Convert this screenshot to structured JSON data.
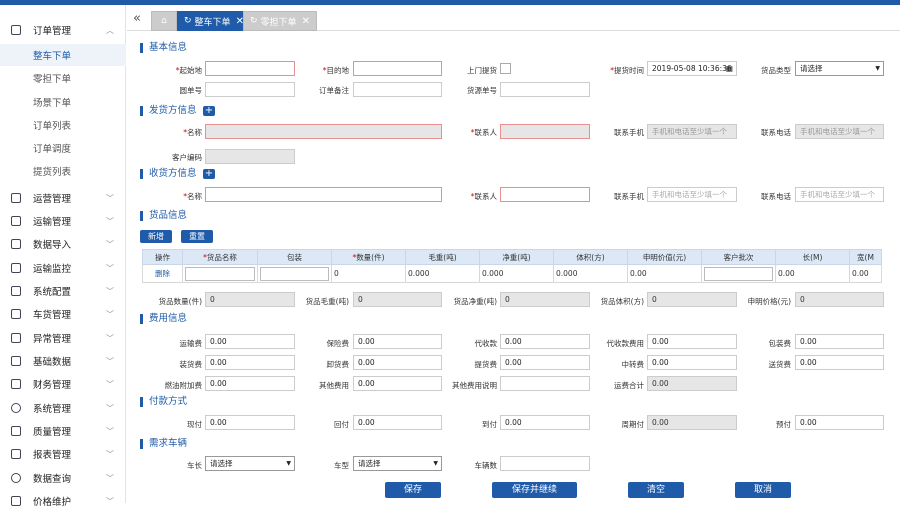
{
  "sidebar": {
    "menus": [
      {
        "label": "订单管理",
        "icon": "document-icon",
        "expanded": true
      },
      {
        "label": "运营管理",
        "icon": "monitor-icon"
      },
      {
        "label": "运输管理",
        "icon": "truck-icon"
      },
      {
        "label": "数据导入",
        "icon": "upload-icon"
      },
      {
        "label": "运输监控",
        "icon": "camera-icon"
      },
      {
        "label": "系统配置",
        "icon": "settings-icon"
      },
      {
        "label": "车货管理",
        "icon": "cart-icon"
      },
      {
        "label": "异常管理",
        "icon": "warning-icon"
      },
      {
        "label": "基础数据",
        "icon": "grid-icon"
      },
      {
        "label": "财务管理",
        "icon": "finance-icon"
      },
      {
        "label": "系统管理",
        "icon": "gear-icon"
      },
      {
        "label": "质量管理",
        "icon": "shield-icon"
      },
      {
        "label": "报表管理",
        "icon": "report-icon"
      },
      {
        "label": "数据查询",
        "icon": "search-icon"
      },
      {
        "label": "价格维护",
        "icon": "price-icon"
      }
    ],
    "sub_items": [
      "整车下单",
      "零担下单",
      "场景下单",
      "订单列表",
      "订单调度",
      "提货列表"
    ]
  },
  "tabs": [
    {
      "label": "整车下单",
      "active": true
    },
    {
      "label": "零担下单",
      "active": false
    }
  ],
  "basic": {
    "title": "基本信息",
    "origin_label": "起始地",
    "dest_label": "目的地",
    "pickup_label": "上门提货",
    "pickup_time_label": "提货时间",
    "pickup_time_value": "2019-05-08 10:36:36",
    "goods_type_label": "货品类型",
    "goods_type_value": "请选择",
    "circle_no_label": "圆单号",
    "order_note_label": "订单备注",
    "source_no_label": "货源单号"
  },
  "shipper": {
    "title": "发货方信息",
    "name_label": "名称",
    "contact_label": "联系人",
    "mobile_label": "联系手机",
    "mobile_ph": "手机和电话至少填一个",
    "phone_label": "联系电话",
    "phone_ph": "手机和电话至少填一个",
    "code_label": "客户编码"
  },
  "receiver": {
    "title": "收货方信息",
    "name_label": "名称",
    "contact_label": "联系人",
    "mobile_label": "联系手机",
    "mobile_ph": "手机和电话至少填一个",
    "phone_label": "联系电话",
    "phone_ph": "手机和电话至少填一个"
  },
  "goods": {
    "title": "货品信息",
    "add_label": "新增",
    "reset_label": "重置",
    "columns": [
      "操作",
      "货品名称",
      "包装",
      "数量(件)",
      "毛重(吨)",
      "净重(吨)",
      "体积(方)",
      "申明价值(元)",
      "客户批次",
      "长(M)",
      "宽(M"
    ],
    "row": {
      "delete": "删除",
      "qty": "0",
      "gross": "0.000",
      "net": "0.000",
      "volume": "0.000",
      "value": "0.00",
      "length": "0.00",
      "width": "0.00"
    },
    "sum_qty_label": "货品数量(件)",
    "sum_qty": "0",
    "sum_gross_label": "货品毛重(吨)",
    "sum_gross": "0",
    "sum_net_label": "货品净重(吨)",
    "sum_net": "0",
    "sum_vol_label": "货品体积(方)",
    "sum_vol": "0",
    "sum_value_label": "申明价格(元)",
    "sum_value": "0"
  },
  "fees": {
    "title": "费用信息",
    "rows": [
      [
        {
          "label": "运输费",
          "value": "0.00"
        },
        {
          "label": "保险费",
          "value": "0.00"
        },
        {
          "label": "代收款",
          "value": "0.00"
        },
        {
          "label": "代收款费用",
          "value": "0.00"
        },
        {
          "label": "包装费",
          "value": "0.00"
        }
      ],
      [
        {
          "label": "装货费",
          "value": "0.00"
        },
        {
          "label": "卸货费",
          "value": "0.00"
        },
        {
          "label": "提货费",
          "value": "0.00"
        },
        {
          "label": "中转费",
          "value": "0.00"
        },
        {
          "label": "送货费",
          "value": "0.00"
        }
      ],
      [
        {
          "label": "燃油附加费",
          "value": "0.00"
        },
        {
          "label": "其他费用",
          "value": "0.00"
        },
        {
          "label": "其他费用说明",
          "value": ""
        },
        {
          "label": "运费合计",
          "value": "0.00"
        }
      ]
    ]
  },
  "payment": {
    "title": "付款方式",
    "items": [
      {
        "label": "现付",
        "value": "0.00"
      },
      {
        "label": "回付",
        "value": "0.00"
      },
      {
        "label": "到付",
        "value": "0.00"
      },
      {
        "label": "周期付",
        "value": "0.00"
      },
      {
        "label": "预付",
        "value": "0.00"
      }
    ]
  },
  "vehicle": {
    "title": "需求车辆",
    "length_label": "车长",
    "length_value": "请选择",
    "type_label": "车型",
    "type_value": "请选择",
    "count_label": "车辆数"
  },
  "actions": {
    "save": "保存",
    "save_continue": "保存并继续",
    "clear": "清空",
    "cancel": "取消"
  },
  "colors": {
    "accent": "#1f5ba8",
    "table_head": "#dce8f6"
  }
}
